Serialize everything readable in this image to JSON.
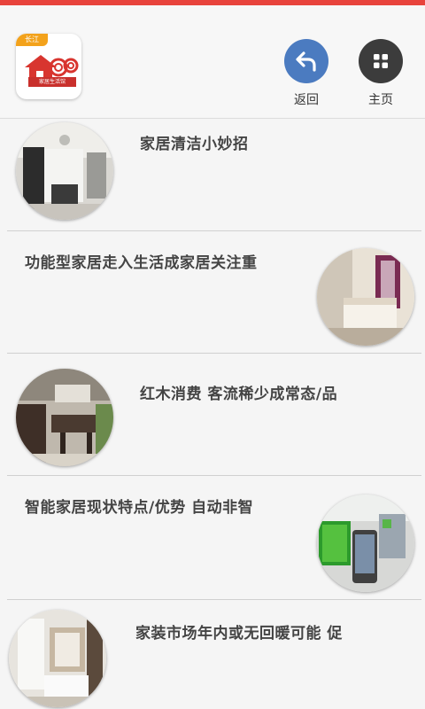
{
  "app": {
    "logo_ribbon": "长江",
    "logo_caption": "家居生活馆"
  },
  "header": {
    "back_label": "返回",
    "home_label": "主页"
  },
  "articles": [
    {
      "title": "家居清洁小妙招"
    },
    {
      "title": "功能型家居走入生活成家居关注重"
    },
    {
      "title": "红木消费 客流稀少成常态/品"
    },
    {
      "title": "智能家居现状特点/优势 自动非智"
    },
    {
      "title": "家装市场年内或无回暖可能 促"
    }
  ],
  "colors": {
    "top_accent": "#e8433c",
    "back_button": "#4b7bc0",
    "home_button": "#3c3c3c"
  },
  "icons": {
    "back": "back-arrow-icon",
    "home": "grid-icon"
  }
}
